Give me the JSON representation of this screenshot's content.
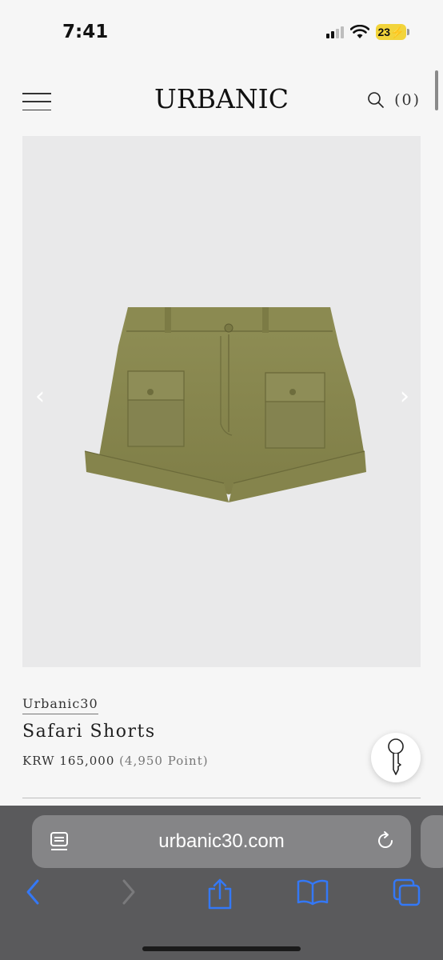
{
  "status_bar": {
    "time": "7:41",
    "battery": "23"
  },
  "header": {
    "logo": "URBANIC",
    "cart_label": "(0)"
  },
  "product": {
    "brand": "Urbanic30",
    "name": "Safari Shorts",
    "price": "KRW 165,000",
    "points": "(4,950 Point)"
  },
  "browser": {
    "url": "urbanic30.com"
  },
  "icons": [
    "menu-icon",
    "search-icon",
    "key-icon",
    "reader-icon",
    "reload-icon",
    "back-icon",
    "forward-icon",
    "share-icon",
    "bookmarks-icon",
    "tabs-icon"
  ],
  "colors": {
    "accent": "#3478f6",
    "product_bg": "#e9e9ea",
    "shorts": "#8a8a4e"
  }
}
